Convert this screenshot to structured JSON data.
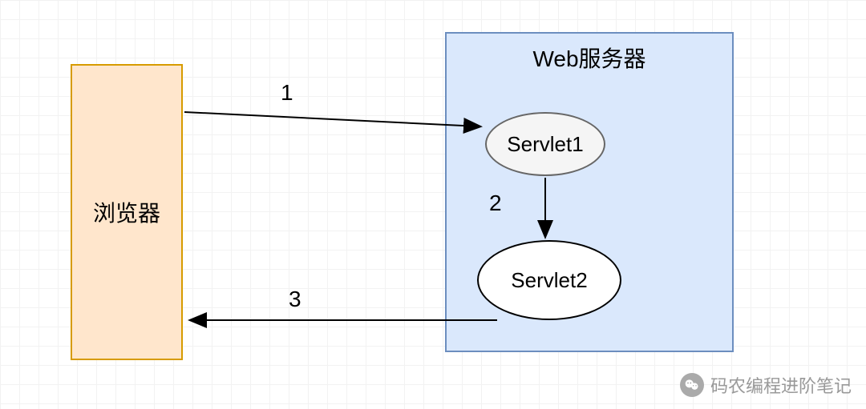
{
  "diagram": {
    "browser_label": "浏览器",
    "server_label": "Web服务器",
    "servlet1_label": "Servlet1",
    "servlet2_label": "Servlet2",
    "arrow_labels": {
      "one": "1",
      "two": "2",
      "three": "3"
    },
    "arrows": [
      {
        "id": "1",
        "from": "browser",
        "to": "servlet1",
        "desc": "request from browser to Servlet1"
      },
      {
        "id": "2",
        "from": "servlet1",
        "to": "servlet2",
        "desc": "forward from Servlet1 to Servlet2"
      },
      {
        "id": "3",
        "from": "servlet2",
        "to": "browser",
        "desc": "response from Servlet2 to browser"
      }
    ]
  },
  "watermark": {
    "text": "码农编程进阶笔记",
    "icon": "wechat-icon"
  }
}
